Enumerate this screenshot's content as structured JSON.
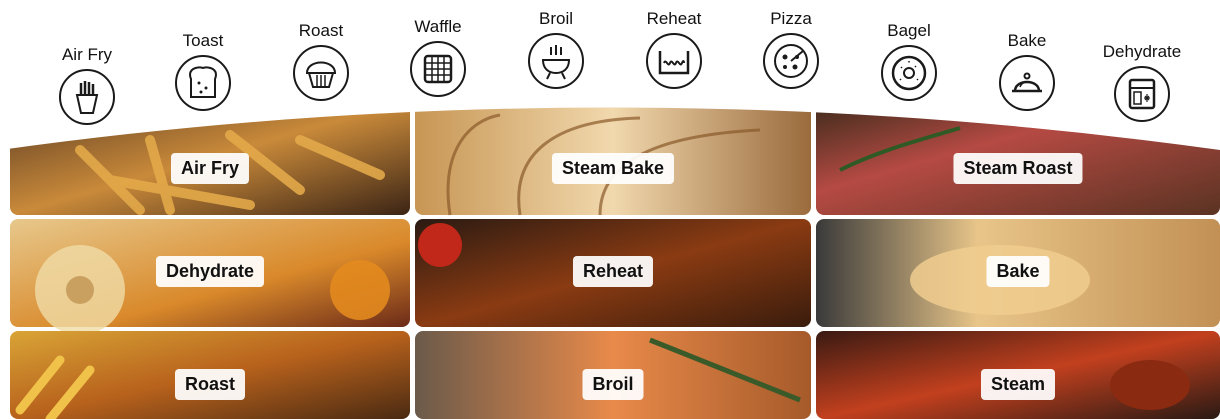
{
  "modes": [
    {
      "label": "Air Fry",
      "icon": "fries-icon"
    },
    {
      "label": "Toast",
      "icon": "toast-icon"
    },
    {
      "label": "Roast",
      "icon": "muffin-icon"
    },
    {
      "label": "Waffle",
      "icon": "waffle-icon"
    },
    {
      "label": "Broil",
      "icon": "grill-icon"
    },
    {
      "label": "Reheat",
      "icon": "reheat-icon"
    },
    {
      "label": "Pizza",
      "icon": "pizza-icon"
    },
    {
      "label": "Bagel",
      "icon": "bagel-icon"
    },
    {
      "label": "Bake",
      "icon": "cloche-icon"
    },
    {
      "label": "Dehydrate",
      "icon": "dehydrator-icon"
    }
  ],
  "tiles": [
    {
      "label": "Air Fry",
      "image": "french fries"
    },
    {
      "label": "Steam Bake",
      "image": "sliced bread"
    },
    {
      "label": "Steam Roast",
      "image": "grilled steak with rosemary"
    },
    {
      "label": "Dehydrate",
      "image": "dried fruit"
    },
    {
      "label": "Reheat",
      "image": "bbq ribs"
    },
    {
      "label": "Bake",
      "image": "croissants"
    },
    {
      "label": "Roast",
      "image": "roast chicken with fries"
    },
    {
      "label": "Broil",
      "image": "grilled salmon with rosemary"
    },
    {
      "label": "Steam",
      "image": "lobster with sauce"
    }
  ],
  "colors": {
    "icon_stroke": "#1a1a1a",
    "caption_bg": "#ffffff"
  }
}
